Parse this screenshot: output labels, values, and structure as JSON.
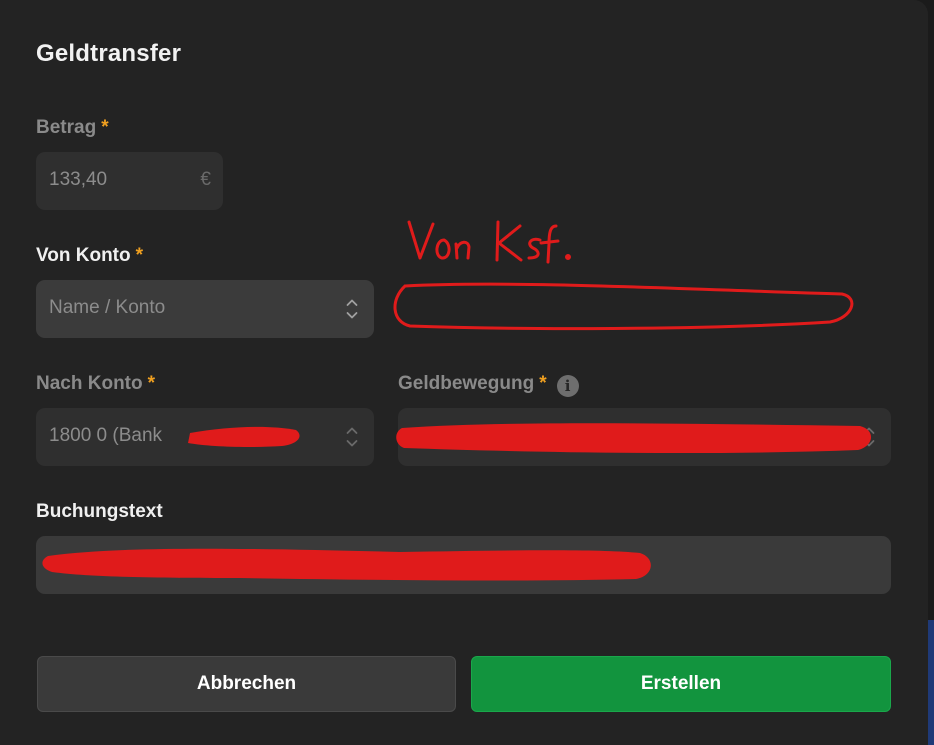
{
  "dialog": {
    "title": "Geldtransfer"
  },
  "amount": {
    "label": "Betrag",
    "required_mark": "*",
    "value": "133,40",
    "currency_symbol": "€"
  },
  "from_account": {
    "label": "Von Konto",
    "required_mark": "*",
    "placeholder": "Name / Konto"
  },
  "to_account": {
    "label": "Nach Konto",
    "required_mark": "*",
    "value": "1800 0 (Bank"
  },
  "movement": {
    "label": "Geldbewegung",
    "required_mark": "*",
    "info_icon": "info-icon"
  },
  "posting_text": {
    "label": "Buchungstext"
  },
  "buttons": {
    "cancel_label": "Abbrechen",
    "create_label": "Erstellen"
  },
  "annotation": {
    "handwritten_note": "Von Ksf."
  },
  "colors": {
    "accent_required": "#f0a020",
    "create_button": "#12943e",
    "annotation_red": "#e01b1b"
  }
}
